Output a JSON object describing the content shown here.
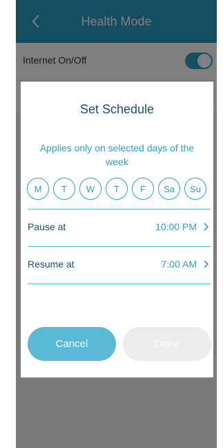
{
  "header": {
    "title": "Health Mode"
  },
  "settings_row": {
    "label": "Internet On/Off",
    "toggle_on": true
  },
  "dialog": {
    "title": "Set Schedule",
    "subtitle": "Applies only on selected days of the week",
    "days": [
      "M",
      "T",
      "W",
      "T",
      "F",
      "Sa",
      "Su"
    ],
    "pause": {
      "label": "Pause at",
      "value": "10:00 PM"
    },
    "resume": {
      "label": "Resume at",
      "value": "7:00 AM"
    },
    "cancel_label": "Cancel",
    "done_label": "Done"
  },
  "colors": {
    "accent": "#2ca2c8",
    "header_bg": "#2c9cc3",
    "title_text": "#1f4f69",
    "cancel_bg": "#5bb8d6",
    "done_bg": "#ececec"
  },
  "icons": {
    "back": "chevron-left-icon",
    "row_arrow": "chevron-right-icon"
  }
}
